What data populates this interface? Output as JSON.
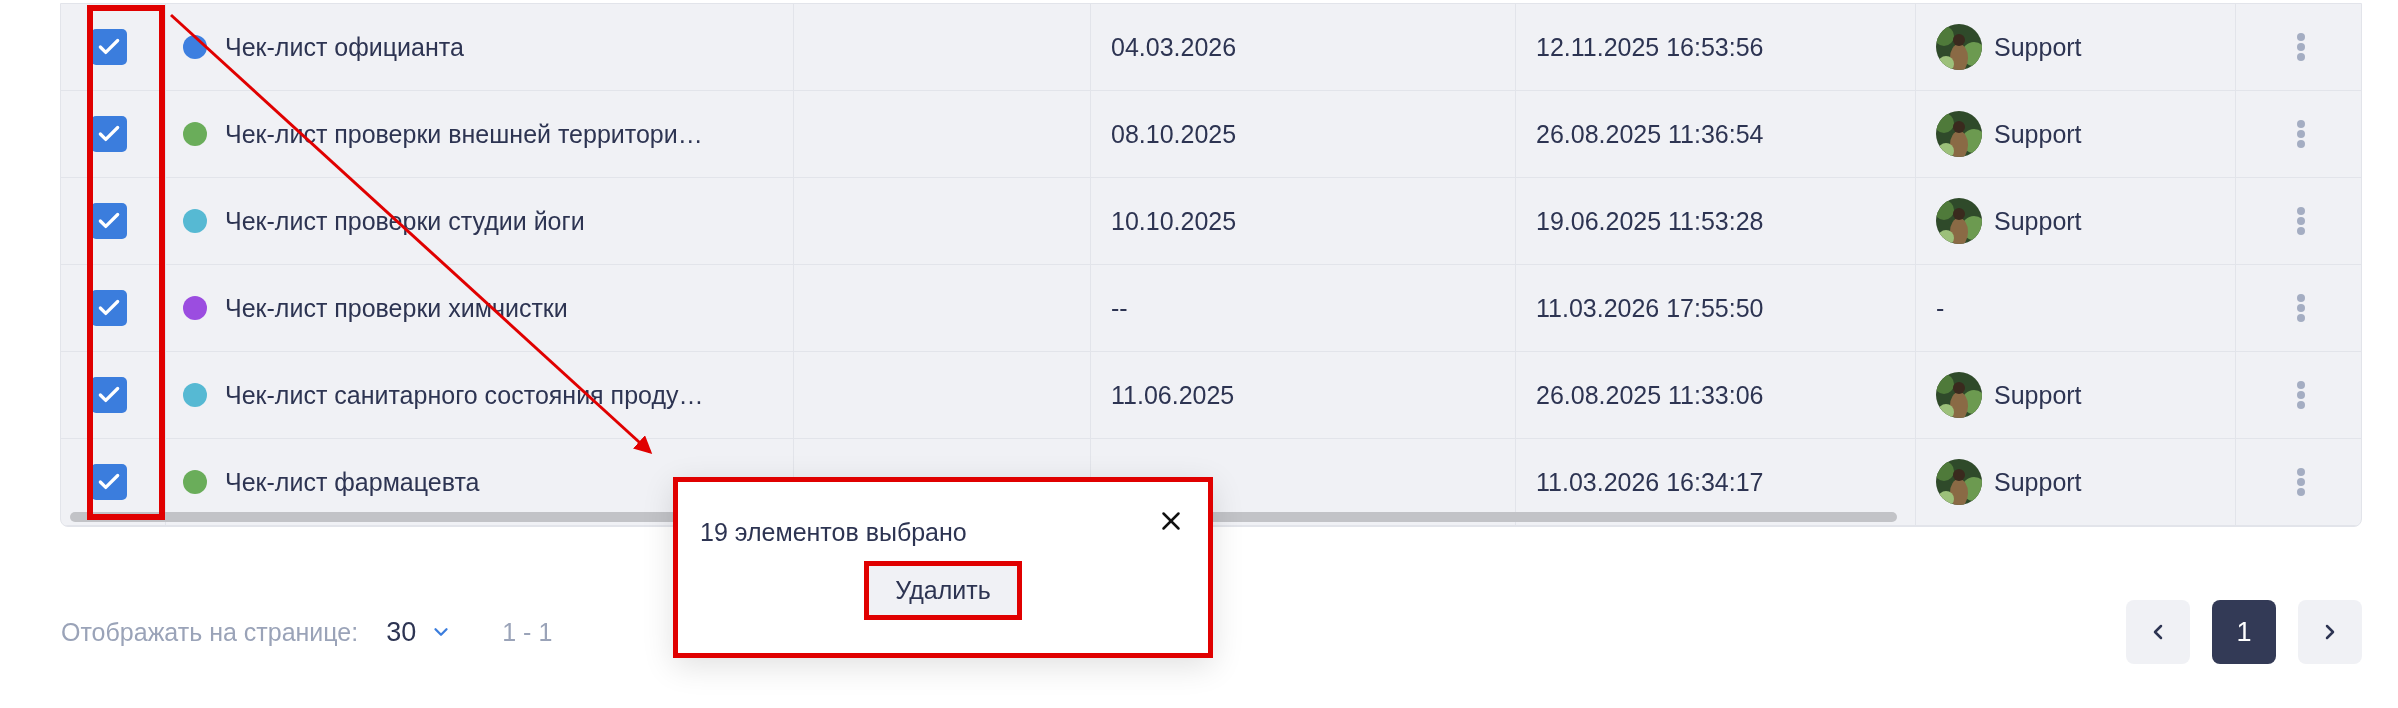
{
  "rows": [
    {
      "checked": true,
      "color": "#3d7fe0",
      "column_2": "Чек-лист официанта",
      "column_4": "04.03.2026",
      "column_5": "12.11.2025 16:53:56",
      "avatar": true,
      "column_6": "Support"
    },
    {
      "checked": true,
      "color": "#6aad5a",
      "column_2": "Чек-лист проверки внешней территори…",
      "column_4": "08.10.2025",
      "column_5": "26.08.2025 11:36:54",
      "avatar": true,
      "column_6": "Support"
    },
    {
      "checked": true,
      "color": "#56b9d3",
      "column_2": "Чек-лист проверки студии йоги",
      "column_4": "10.10.2025",
      "column_5": "19.06.2025 11:53:28",
      "avatar": true,
      "column_6": "Support"
    },
    {
      "checked": true,
      "color": "#9b4de0",
      "column_2": "Чек-лист проверки химчистки",
      "column_4": "--",
      "column_5": "11.03.2026 17:55:50",
      "avatar": false,
      "column_6": "-"
    },
    {
      "checked": true,
      "color": "#56b9d3",
      "column_2": "Чек-лист санитарного состояния проду…",
      "column_4": "11.06.2025",
      "column_5": "26.08.2025 11:33:06",
      "avatar": true,
      "column_6": "Support"
    },
    {
      "checked": true,
      "color": "#6aad5a",
      "column_2": "Чек-лист фармацевта",
      "column_5": "11.03.2026 16:34:17",
      "avatar": true,
      "column_6": "Support"
    }
  ],
  "pagination": {
    "label": "Отображать на странице:",
    "per_page": "30",
    "range": "1 - 1",
    "pages": [
      {
        "label": "1",
        "selected": true
      }
    ]
  },
  "popup": {
    "message": "19 элементов выбрано",
    "button": "Удалить"
  },
  "highlights": {
    "checkboxes": true,
    "arrow": true,
    "popup": true,
    "delete_button": true
  }
}
